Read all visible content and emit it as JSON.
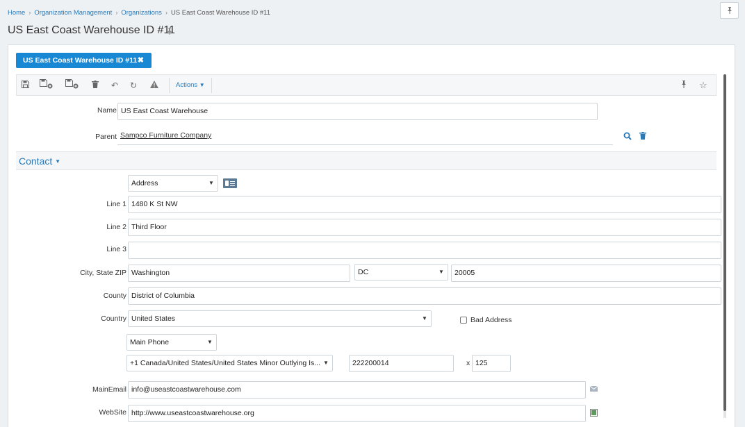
{
  "breadcrumb": {
    "items": [
      "Home",
      "Organization Management",
      "Organizations"
    ],
    "current": "US East Coast Warehouse ID #11"
  },
  "page": {
    "title": "US East Coast Warehouse ID #11",
    "pin_icon": "pin-icon",
    "corner_pin_icon": "pin-icon"
  },
  "tab": {
    "label": "US East Coast Warehouse ID #11",
    "close_icon": "close-icon"
  },
  "toolbar": {
    "icons": [
      "save-icon",
      "save-close-icon",
      "save-new-icon",
      "delete-icon",
      "undo-icon",
      "refresh-icon",
      "warning-icon"
    ],
    "actions_label": "Actions",
    "right_icons": [
      "pin-icon",
      "star-icon"
    ]
  },
  "form": {
    "name_label": "Name",
    "name_value": "US East Coast Warehouse",
    "parent_label": "Parent",
    "parent_value": "Sampco Furniture Company"
  },
  "contact": {
    "section_title": "Contact",
    "address_type": "Address",
    "line1_label": "Line 1",
    "line1_value": "1480 K St NW",
    "line2_label": "Line 2",
    "line2_value": "Third Floor",
    "line3_label": "Line 3",
    "line3_value": "",
    "city_label": "City, State ZIP",
    "city_value": "Washington",
    "state_value": "DC",
    "zip_value": "20005",
    "county_label": "County",
    "county_value": "District of Columbia",
    "country_label": "Country",
    "country_value": "United States",
    "bad_address_label": "Bad Address",
    "phone_type": "Main Phone",
    "phone_country": "+1 Canada/United States/United States Minor Outlying Is...",
    "phone_number": "222200014",
    "ext_label": "x",
    "ext_value": "125",
    "email_label": "MainEmail",
    "email_value": "info@useastcoastwarehouse.com",
    "website_label": "WebSite",
    "website_value": "http://www.useastcoastwarehouse.org"
  },
  "colors": {
    "accent": "#1888d4",
    "link": "#2a7ab8",
    "background": "#eef1f4"
  }
}
